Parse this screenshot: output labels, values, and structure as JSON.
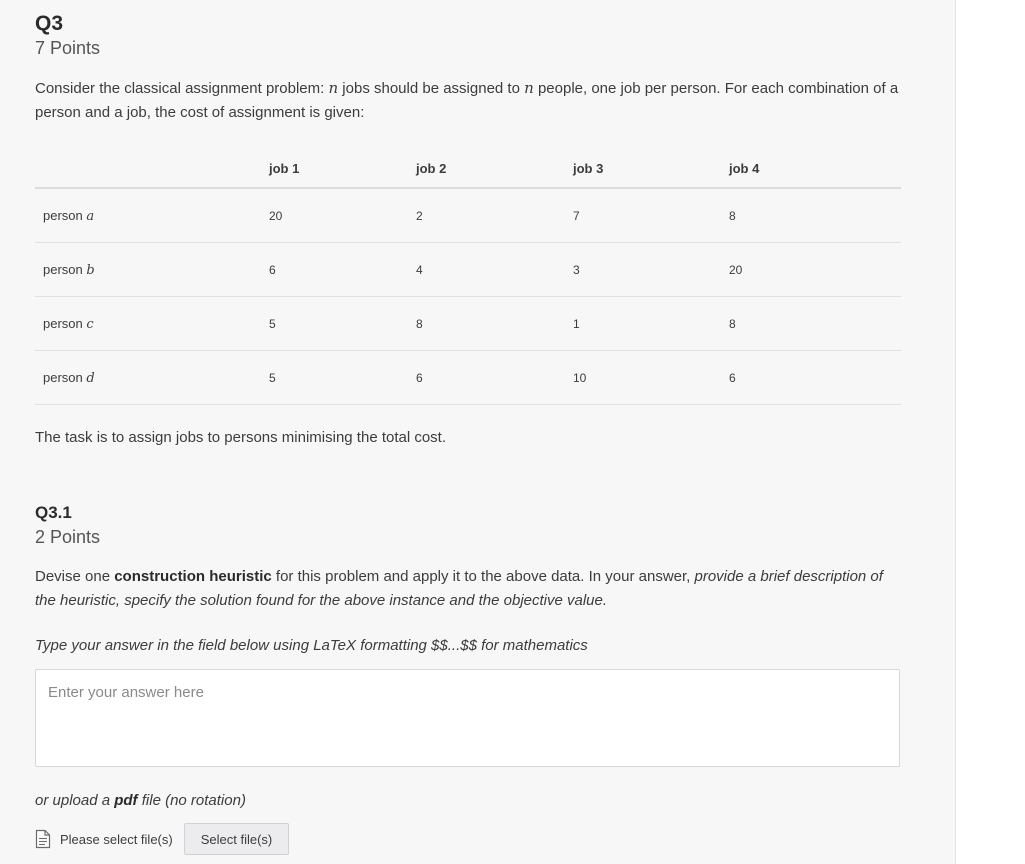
{
  "question": {
    "title": "Q3",
    "points": "7 Points",
    "prompt": {
      "p1": "Consider the classical assignment problem: ",
      "var_n": "n",
      "p2": " jobs should be assigned to ",
      "p3": " people, one job per person. For each combination of a person and a job, the cost of assignment is given:"
    },
    "table": {
      "headers": [
        "",
        "job 1",
        "job 2",
        "job 3",
        "job 4"
      ],
      "rows": [
        {
          "label": "person ",
          "var": "a",
          "values": [
            "20",
            "2",
            "7",
            "8"
          ]
        },
        {
          "label": "person ",
          "var": "b",
          "values": [
            "6",
            "4",
            "3",
            "20"
          ]
        },
        {
          "label": "person ",
          "var": "c",
          "values": [
            "5",
            "8",
            "1",
            "8"
          ]
        },
        {
          "label": "person ",
          "var": "d",
          "values": [
            "5",
            "6",
            "10",
            "6"
          ]
        }
      ]
    },
    "task_text": "The task is to assign jobs to persons minimising the total cost."
  },
  "subquestion": {
    "title": "Q3.1",
    "points": "2 Points",
    "prompt": {
      "p1": "Devise one ",
      "bold": "construction heuristic",
      "p2": " for this problem and apply it to the above data. In your answer, ",
      "italic": "provide a brief description of the heuristic, specify the solution found for the above instance and the objective value."
    },
    "instructions": "Type your answer in the field below using LaTeX formatting $$...$$ for mathematics",
    "answer": {
      "placeholder": "Enter your answer here",
      "value": ""
    },
    "upload": {
      "prefix": "or upload a ",
      "bold": "pdf",
      "suffix": " file (no rotation)",
      "file_status": "Please select file(s)",
      "button_label": "Select file(s)",
      "icon": "document-icon"
    }
  }
}
